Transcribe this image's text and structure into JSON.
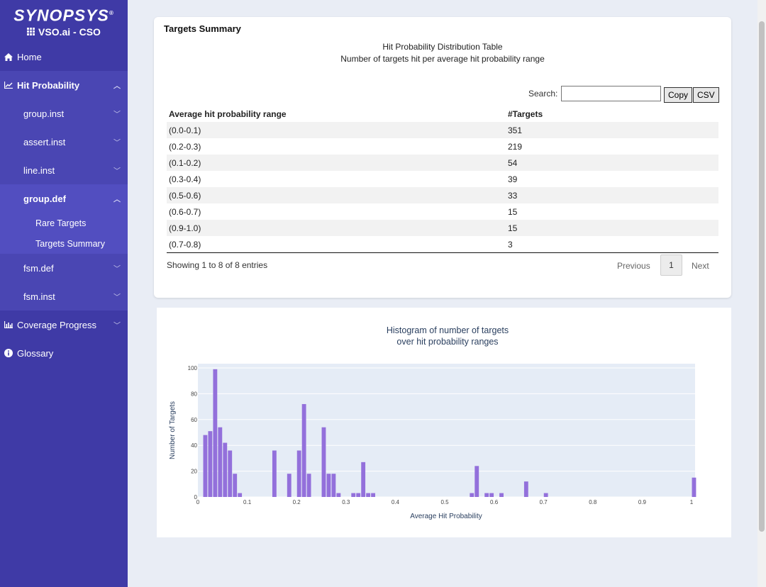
{
  "sidebar": {
    "brand": "SYNOPSYS",
    "product": "VSO.ai - CSO",
    "items": [
      {
        "label": "Home"
      },
      {
        "label": "Hit Probability"
      },
      {
        "label": "group.inst"
      },
      {
        "label": "assert.inst"
      },
      {
        "label": "line.inst"
      },
      {
        "label": "group.def"
      },
      {
        "label": "Rare Targets"
      },
      {
        "label": "Targets Summary"
      },
      {
        "label": "fsm.def"
      },
      {
        "label": "fsm.inst"
      },
      {
        "label": "Coverage Progress"
      },
      {
        "label": "Glossary"
      }
    ]
  },
  "summary": {
    "title": "Targets Summary",
    "caption1": "Hit Probability Distribution Table",
    "caption2": "Number of targets hit per average hit probability range",
    "search_label": "Search:",
    "search_value": "",
    "copy_label": "Copy",
    "csv_label": "CSV",
    "columns": [
      "Average hit probability range",
      "#Targets"
    ],
    "rows": [
      [
        "(0.0-0.1)",
        "351"
      ],
      [
        "(0.2-0.3)",
        "219"
      ],
      [
        "(0.1-0.2)",
        "54"
      ],
      [
        "(0.3-0.4)",
        "39"
      ],
      [
        "(0.5-0.6)",
        "33"
      ],
      [
        "(0.6-0.7)",
        "15"
      ],
      [
        "(0.9-1.0)",
        "15"
      ],
      [
        "(0.7-0.8)",
        "3"
      ]
    ],
    "info": "Showing 1 to 8 of 8 entries",
    "previous": "Previous",
    "page": "1",
    "next": "Next"
  },
  "chart_data": {
    "type": "bar",
    "title": "Histogram of number of targets\nover hit probability ranges",
    "xlabel": "Average Hit Probability",
    "ylabel": "Number of Targets",
    "xlim": [
      0,
      1.0
    ],
    "ylim": [
      0,
      100
    ],
    "bin_width": 0.01,
    "x_ticks": [
      "0",
      "0.1",
      "0.2",
      "0.3",
      "0.4",
      "0.5",
      "0.6",
      "0.7",
      "0.8",
      "0.9",
      "1"
    ],
    "y_ticks": [
      "0",
      "20",
      "40",
      "60",
      "80",
      "100"
    ],
    "grid": true,
    "color": "#9370db",
    "bars": [
      {
        "x": 0.015,
        "y": 48
      },
      {
        "x": 0.025,
        "y": 51
      },
      {
        "x": 0.035,
        "y": 99
      },
      {
        "x": 0.045,
        "y": 54
      },
      {
        "x": 0.055,
        "y": 42
      },
      {
        "x": 0.065,
        "y": 36
      },
      {
        "x": 0.075,
        "y": 18
      },
      {
        "x": 0.085,
        "y": 3
      },
      {
        "x": 0.155,
        "y": 36
      },
      {
        "x": 0.185,
        "y": 18
      },
      {
        "x": 0.205,
        "y": 36
      },
      {
        "x": 0.215,
        "y": 72
      },
      {
        "x": 0.225,
        "y": 18
      },
      {
        "x": 0.255,
        "y": 54
      },
      {
        "x": 0.265,
        "y": 18
      },
      {
        "x": 0.275,
        "y": 18
      },
      {
        "x": 0.285,
        "y": 3
      },
      {
        "x": 0.315,
        "y": 3
      },
      {
        "x": 0.325,
        "y": 3
      },
      {
        "x": 0.335,
        "y": 27
      },
      {
        "x": 0.345,
        "y": 3
      },
      {
        "x": 0.355,
        "y": 3
      },
      {
        "x": 0.555,
        "y": 3
      },
      {
        "x": 0.565,
        "y": 24
      },
      {
        "x": 0.585,
        "y": 3
      },
      {
        "x": 0.595,
        "y": 3
      },
      {
        "x": 0.615,
        "y": 3
      },
      {
        "x": 0.665,
        "y": 12
      },
      {
        "x": 0.705,
        "y": 3
      },
      {
        "x": 1.005,
        "y": 15
      }
    ]
  },
  "colors": {
    "sidebar": "#3f3aa6",
    "accent": "#9370db",
    "plot_bg": "#e5ecf6"
  },
  "icons": {
    "home": "home-icon",
    "chart": "line-chart-icon",
    "coverage": "bar-chart-icon",
    "glossary": "info-icon",
    "grid": "grid-icon"
  }
}
